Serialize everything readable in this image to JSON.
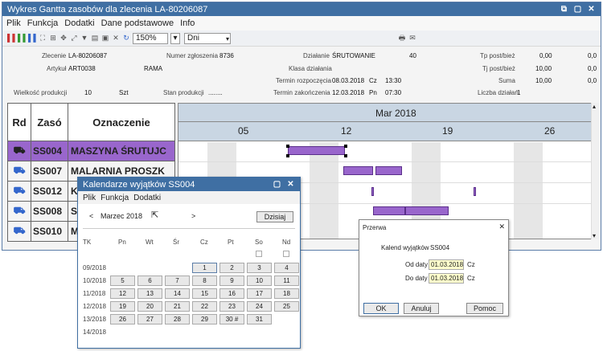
{
  "main": {
    "title": "Wykres Gantta zasobów dla zlecenia  LA-80206087",
    "menu": [
      "Plik",
      "Funkcja",
      "Dodatki",
      "Dane podstawowe",
      "Info"
    ],
    "zoom": "150%",
    "unit": "Dni"
  },
  "info": {
    "zlecenie_label": "Zlecenie",
    "zlecenie": "LA-80206087",
    "artykul_label": "Artykuł",
    "artykul": "ART0038",
    "rama": "RAMA",
    "wielkosc_label": "Wielkość produkcji",
    "wielkosc": "10",
    "szt": "Szt",
    "stan_label": "Stan produkcji",
    "stan": "........",
    "nr_label": "Numer zgłoszenia",
    "nr": "8736",
    "dzialanie_label": "Działanie",
    "dzialanie": "ŚRUTOWANIE",
    "dzialanie_nr": "40",
    "klasa_label": "Klasa działania",
    "trozp_label": "Termin rozpoczęcia",
    "trozp_date": "08.03.2018",
    "trozp_day": "Cz",
    "trozp_time": "13:30",
    "tzak_label": "Termin zakończenia",
    "tzak_date": "12.03.2018",
    "tzak_day": "Pn",
    "tzak_time": "07:30",
    "tp_label": "Tp post/bież",
    "tp1": "0,00",
    "tp2": "0,0",
    "tj_label": "Tj post/bież",
    "tj1": "10,00",
    "tj2": "0,0",
    "suma_label": "Suma",
    "suma1": "10,00",
    "suma2": "0,0",
    "liczba_label": "Liczba działań",
    "liczba": "1"
  },
  "grid": {
    "headers": [
      "Rd",
      "Zasó",
      "Oznaczenie"
    ],
    "rows": [
      {
        "code": "SS004",
        "name": "MASZYNA ŚRUTUJC"
      },
      {
        "code": "SS007",
        "name": "MALARNIA PROSZK"
      },
      {
        "code": "SS012",
        "name": "K"
      },
      {
        "code": "SS008",
        "name": "S"
      },
      {
        "code": "SS010",
        "name": "M"
      }
    ]
  },
  "gantt": {
    "month": "Mar 2018",
    "days": [
      "05",
      "12",
      "19",
      "26"
    ]
  },
  "calendar": {
    "title": "Kalendarze wyjątków SS004",
    "menu": [
      "Plik",
      "Funkcja",
      "Dodatki"
    ],
    "prev": "<",
    "month": "Marzec 2018",
    "next": ">",
    "today": "Dzisiaj",
    "weekdays": [
      "TK",
      "Pn",
      "Wt",
      "Śr",
      "Cz",
      "Pt",
      "So",
      "Nd"
    ],
    "weeks": [
      {
        "wk": "09/2018",
        "days": [
          "",
          "",
          "",
          "1",
          "2",
          "3",
          "4"
        ]
      },
      {
        "wk": "10/2018",
        "days": [
          "5",
          "6",
          "7",
          "8",
          "9",
          "10",
          "11"
        ]
      },
      {
        "wk": "11/2018",
        "days": [
          "12",
          "13",
          "14",
          "15",
          "16",
          "17",
          "18"
        ]
      },
      {
        "wk": "12/2018",
        "days": [
          "19",
          "20",
          "21",
          "22",
          "23",
          "24",
          "25"
        ]
      },
      {
        "wk": "13/2018",
        "days": [
          "26",
          "27",
          "28",
          "29",
          "30 #",
          "31",
          ""
        ]
      },
      {
        "wk": "14/2018",
        "days": [
          "",
          "",
          "",
          "",
          "",
          "",
          ""
        ]
      }
    ]
  },
  "przerwa": {
    "title": "Przerwa",
    "kal_label": "Kalend wyjątków",
    "kal": "SS004",
    "od_label": "Od daty",
    "od": "01.03.2018",
    "od_day": "Cz",
    "do_label": "Do daty",
    "do": "01.03.2018",
    "do_day": "Cz",
    "ok": "OK",
    "anuluj": "Anuluj",
    "pomoc": "Pomoc"
  }
}
